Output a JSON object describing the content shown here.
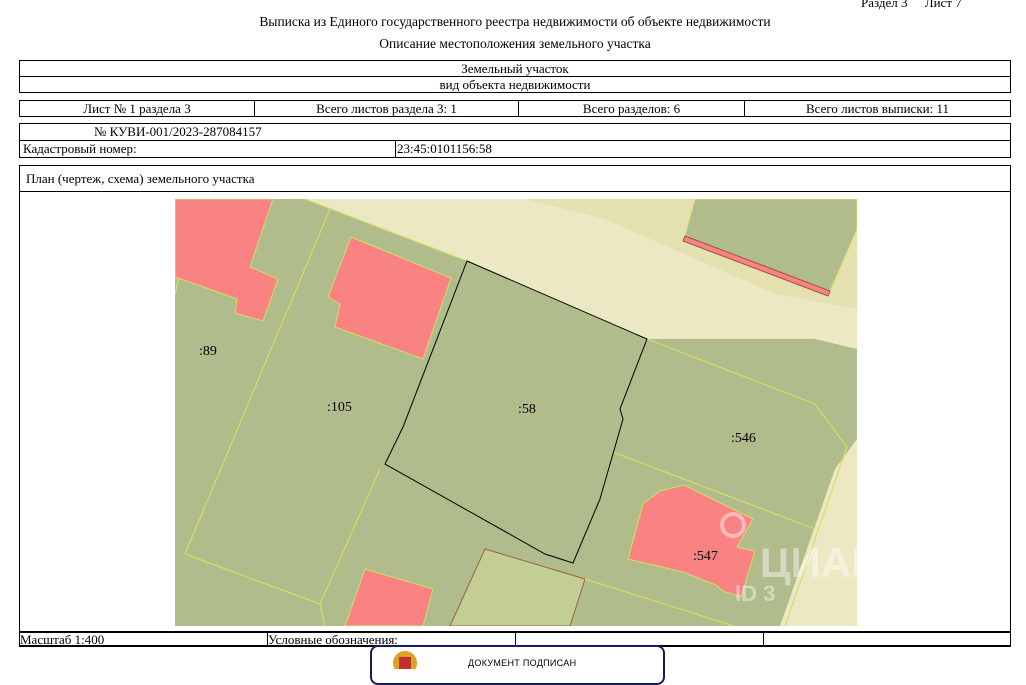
{
  "header": {
    "section": "Раздел 3",
    "sheet": "Лист 7",
    "title": "Выписка из Единого государственного реестра недвижимости об объекте недвижимости",
    "subtitle": "Описание местоположения земельного участка"
  },
  "object": {
    "name": "Земельный участок",
    "kind_caption": "вид объекта недвижимости"
  },
  "sheets_row": {
    "sheet_of_section": "Лист № 1 раздела 3",
    "total_sheets_section": "Всего листов раздела 3: 1",
    "total_sections": "Всего разделов: 6",
    "total_sheets_extract": "Всего листов выписки: 11"
  },
  "request": {
    "number": "№ КУВИ-001/2023-287084157",
    "cadastral_label": "Кадастровый номер:",
    "cadastral_value": "23:45:0101156:58"
  },
  "plan": {
    "caption": "План (чертеж, схема) земельного участка",
    "parcels": [
      ":89",
      ":105",
      ":58",
      ":546",
      ":547"
    ],
    "watermark": "ЦИАН",
    "watermark_id": "ID 3",
    "colors": {
      "parcel": "#b0bc8c",
      "road": "#ece8c4",
      "road_band": "#e4e0b0",
      "building": "#f98282",
      "light_parcel": "#c2ce94",
      "boundary": "#d4e060"
    }
  },
  "footer": {
    "scale": "Масштаб 1:400",
    "legend": "Условные обозначения:",
    "stamp_text": "ДОКУМЕНТ ПОДПИСАН"
  }
}
